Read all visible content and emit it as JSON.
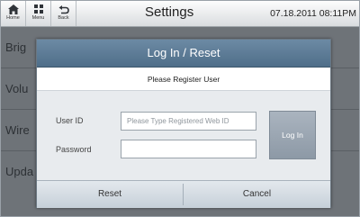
{
  "topbar": {
    "home_label": "Home",
    "menu_label": "Menu",
    "back_label": "Back",
    "title": "Settings",
    "datetime": "07.18.2011 08:11PM"
  },
  "background_list": {
    "items": [
      "Brig",
      "Volu",
      "Wire",
      "Upda"
    ]
  },
  "dialog": {
    "title": "Log In / Reset",
    "subtitle": "Please Register User",
    "user_id_label": "User ID",
    "user_id_placeholder": "Please Type Registered Web ID",
    "user_id_value": "",
    "password_label": "Password",
    "password_value": "",
    "login_label": "Log In",
    "reset_label": "Reset",
    "cancel_label": "Cancel"
  },
  "icons": {
    "home": "home-icon",
    "menu": "grid-menu-icon",
    "back": "back-arrow-icon"
  },
  "colors": {
    "header_blue": "#5a7894",
    "overlay": "#6e7378",
    "button_gray": "#9aa5b1"
  }
}
